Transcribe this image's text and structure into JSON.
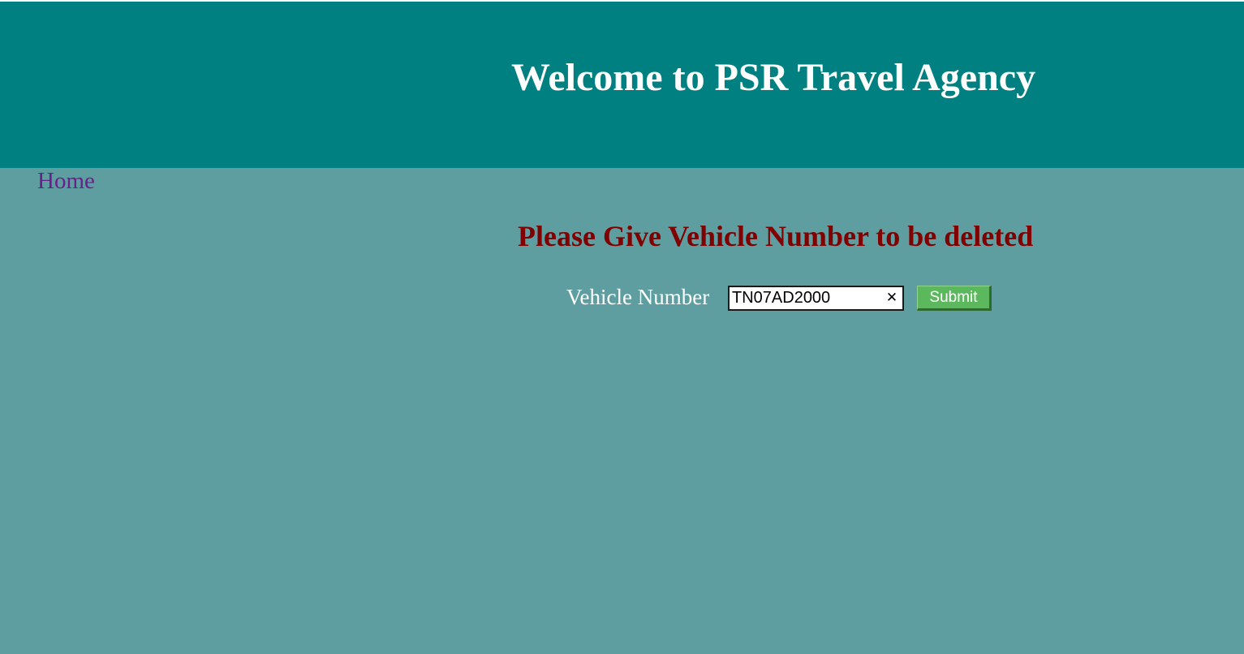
{
  "header": {
    "title": "Welcome to PSR Travel Agency",
    "background_color": "#008080",
    "title_color": "#ffffff"
  },
  "nav": {
    "home_label": "Home",
    "link_color": "#6b1f8c"
  },
  "form": {
    "heading": "Please Give Vehicle Number to be deleted",
    "heading_color": "#800000",
    "field_label": "Vehicle Number",
    "vehicle_number_value": "TN07AD2000",
    "clear_icon": "close-icon",
    "submit_label": "Submit",
    "submit_color": "#5cb85c"
  },
  "page": {
    "background_color": "#5f9ea0"
  }
}
